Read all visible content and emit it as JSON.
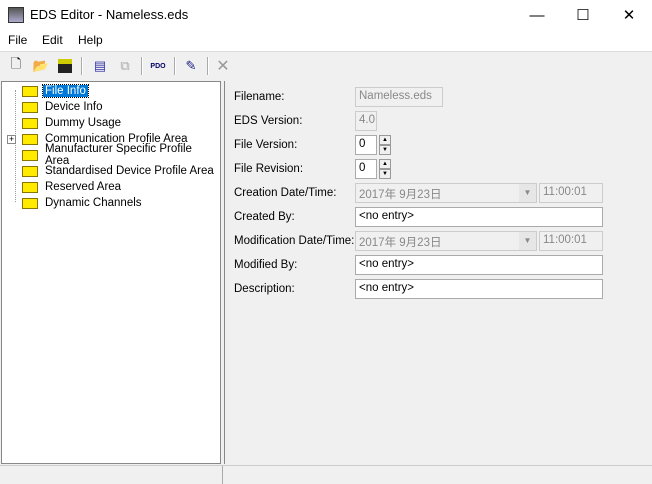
{
  "window": {
    "title": "EDS Editor - Nameless.eds",
    "minimize": "—",
    "maximize": "☐",
    "close": "✕"
  },
  "menu": [
    "File",
    "Edit",
    "Help"
  ],
  "toolbar": {
    "icons": [
      "new-file-icon",
      "open-folder-icon",
      "save-icon",
      "add-object-icon",
      "copy-icon",
      "add-pdo-icon",
      "edit-object-icon",
      "delete-icon"
    ],
    "pdo_label": "PDO"
  },
  "tree": [
    {
      "label": "File Info",
      "selected": true
    },
    {
      "label": "Device Info"
    },
    {
      "label": "Dummy Usage"
    },
    {
      "label": "Communication Profile Area",
      "expandable": true
    },
    {
      "label": "Manufacturer Specific Profile Area"
    },
    {
      "label": "Standardised Device Profile Area"
    },
    {
      "label": "Reserved Area"
    },
    {
      "label": "Dynamic Channels"
    }
  ],
  "form": {
    "filename_label": "Filename:",
    "filename": "Nameless.eds",
    "eds_version_label": "EDS Version:",
    "eds_version": "4.0",
    "file_version_label": "File Version:",
    "file_version": "0",
    "file_revision_label": "File Revision:",
    "file_revision": "0",
    "creation_label": "Creation Date/Time:",
    "creation_date": "2017年  9月23日",
    "creation_time": "11:00:01",
    "created_by_label": "Created By:",
    "created_by": "<no entry>",
    "modification_label": "Modification Date/Time:",
    "modification_date": "2017年  9月23日",
    "modification_time": "11:00:01",
    "modified_by_label": "Modified By:",
    "modified_by": "<no entry>",
    "description_label": "Description:",
    "description": "<no entry>"
  }
}
